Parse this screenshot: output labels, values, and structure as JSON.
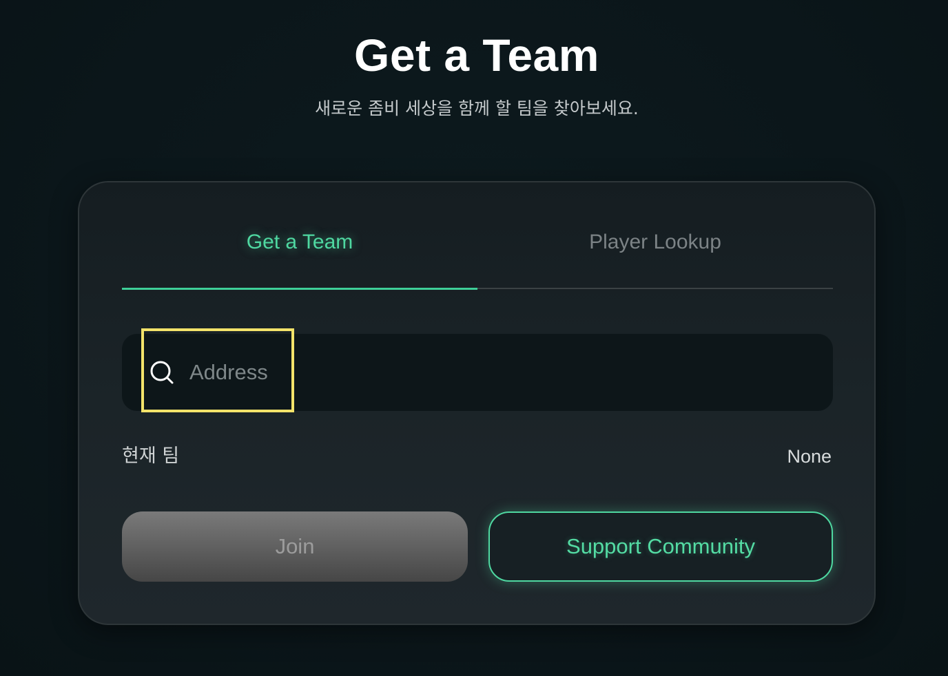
{
  "header": {
    "title": "Get a Team",
    "subtitle": "새로운 좀비 세상을 함께 할 팀을 찾아보세요."
  },
  "tabs": [
    {
      "label": "Get a Team",
      "active": true
    },
    {
      "label": "Player Lookup",
      "active": false
    }
  ],
  "search": {
    "placeholder": "Address",
    "value": "",
    "icon": "search-icon"
  },
  "current_team": {
    "label": "현재 팀",
    "value": "None"
  },
  "buttons": {
    "join_label": "Join",
    "support_label": "Support Community"
  },
  "colors": {
    "accent": "#4fd8a1",
    "background": "#0b161a",
    "focus_highlight": "#f3e36a"
  }
}
